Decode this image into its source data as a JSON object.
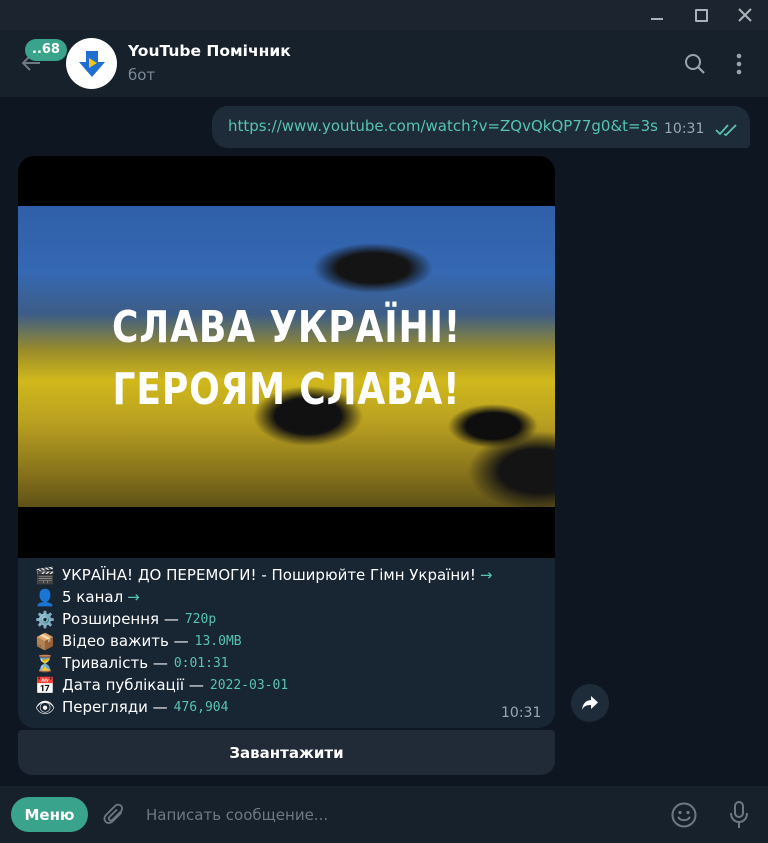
{
  "header": {
    "unread_count": "..68",
    "title": "YouTube Помічник",
    "subtitle": "бот"
  },
  "outgoing": {
    "link": "https://www.youtube.com/watch?v=ZQvQkQP77g0&t=3s",
    "time": "10:31"
  },
  "card": {
    "thumbnail_line1": "СЛАВА УКРАЇНІ!",
    "thumbnail_line2": "ГЕРОЯМ СЛАВА!",
    "rows": [
      {
        "emoji": "🎬",
        "label": "УКРАЇНА! ДО ПЕРЕМОГИ! - Поширюйте Гімн України!",
        "arrow": "→",
        "value": ""
      },
      {
        "emoji": "👤",
        "label": "5 канал",
        "arrow": "→",
        "value": ""
      },
      {
        "emoji": "⚙️",
        "label": "Розширення —",
        "arrow": "",
        "value": "720p"
      },
      {
        "emoji": "📦",
        "label": "Відео важить —",
        "arrow": "",
        "value": "13.0MB"
      },
      {
        "emoji": "⏳",
        "label": "Тривалість —",
        "arrow": "",
        "value": "0:01:31"
      },
      {
        "emoji": "📅",
        "label": "Дата публікації —",
        "arrow": "",
        "value": "2022-03-01"
      },
      {
        "emoji": "👁",
        "label": "Перегляди —",
        "arrow": "",
        "value": "476,904"
      }
    ],
    "time": "10:31"
  },
  "download_button": "Завантажити",
  "input": {
    "menu_label": "Меню",
    "placeholder": "Написать сообщение..."
  },
  "colors": {
    "accent": "#3aa38b",
    "link": "#57c3b0",
    "background": "#0e1621",
    "panel": "#17212b"
  }
}
